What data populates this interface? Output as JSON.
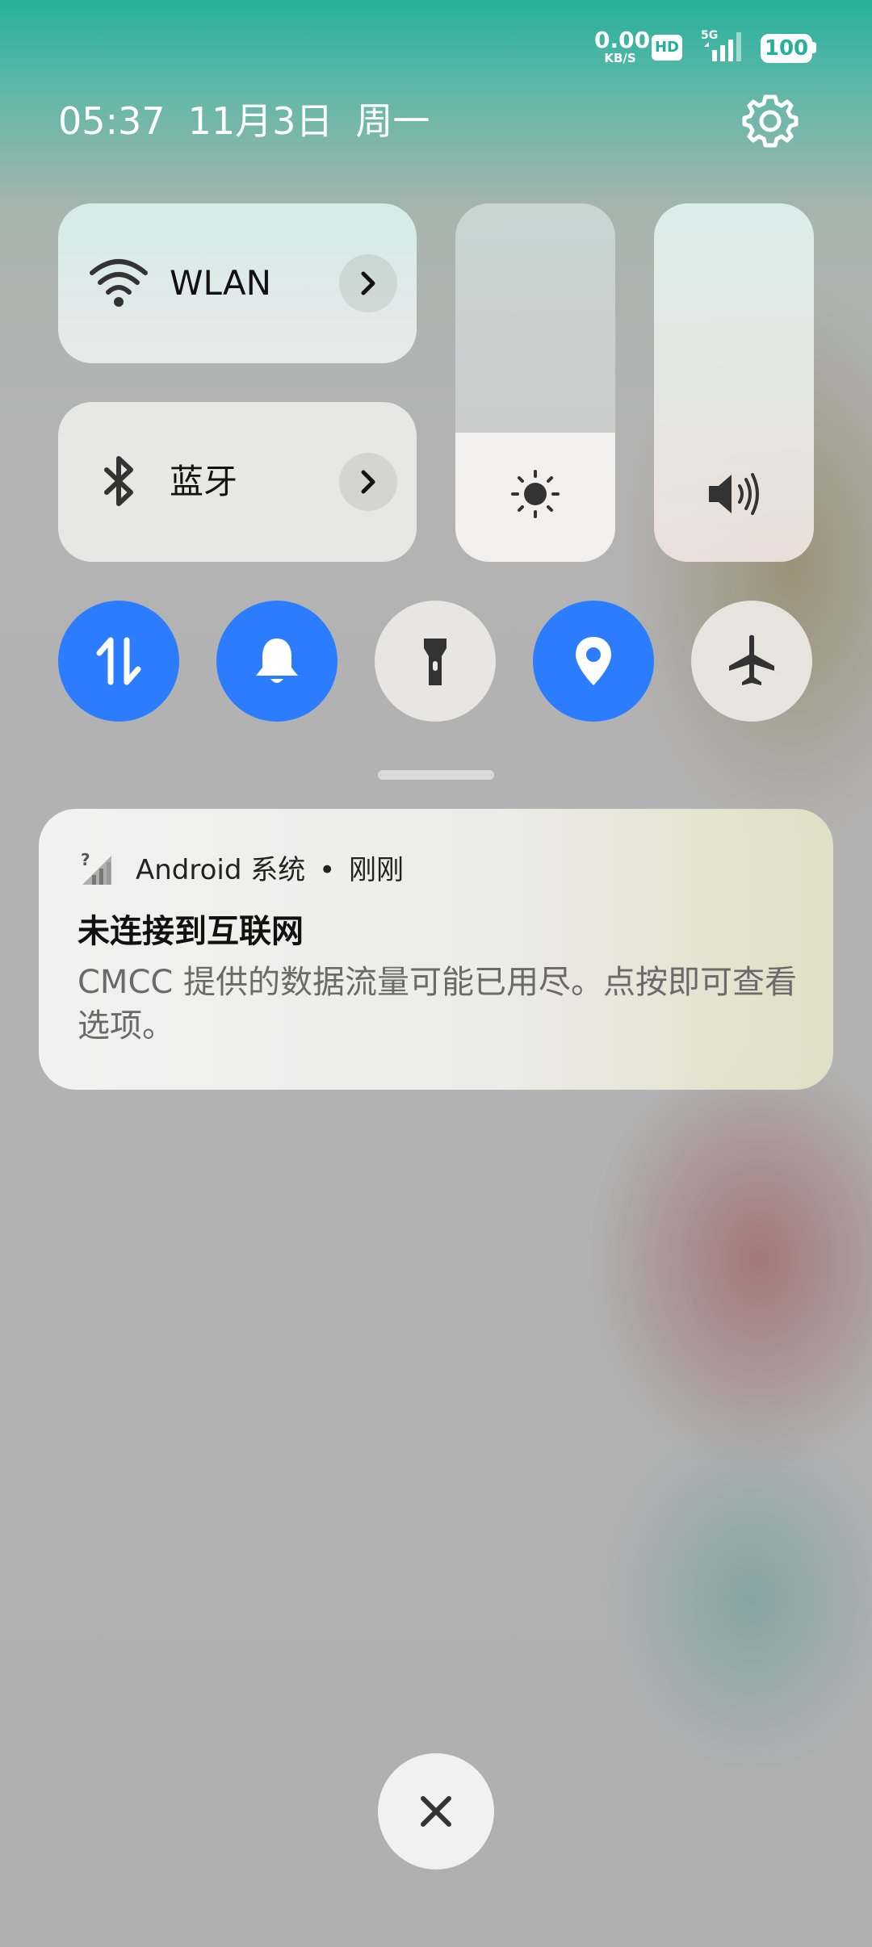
{
  "status_bar": {
    "net_speed_value": "0.00",
    "net_speed_unit": "KB/S",
    "hd_badge": "HD",
    "network_type": "5G",
    "battery_level": "100",
    "accent_color": "#25b09a"
  },
  "header": {
    "time": "05:37",
    "date": "11月3日",
    "weekday": "周一",
    "settings_icon": "gear-icon"
  },
  "tiles": {
    "wlan": {
      "label": "WLAN",
      "icon": "wifi-icon",
      "arrow_icon": "chevron-right-icon"
    },
    "bluetooth": {
      "label": "蓝牙",
      "icon": "bluetooth-icon",
      "arrow_icon": "chevron-right-icon"
    }
  },
  "sliders": {
    "brightness": {
      "icon": "sun-icon",
      "level": 0.36
    },
    "volume": {
      "icon": "speaker-icon",
      "level": 1.0
    }
  },
  "toggles": [
    {
      "name": "mobile-data",
      "icon": "data-arrows-icon",
      "active": true
    },
    {
      "name": "sound",
      "icon": "bell-icon",
      "active": true
    },
    {
      "name": "flashlight",
      "icon": "flashlight-icon",
      "active": false
    },
    {
      "name": "location",
      "icon": "location-pin-icon",
      "active": true
    },
    {
      "name": "airplane-mode",
      "icon": "airplane-icon",
      "active": false
    }
  ],
  "toggle_active_color": "#2b7cff",
  "notification": {
    "icon": "no-signal-icon",
    "app": "Android 系统",
    "separator": "•",
    "time": "刚刚",
    "title": "未连接到互联网",
    "body": "CMCC 提供的数据流量可能已用尽。点按即可查看选项。"
  },
  "close_button": {
    "icon": "close-icon"
  }
}
